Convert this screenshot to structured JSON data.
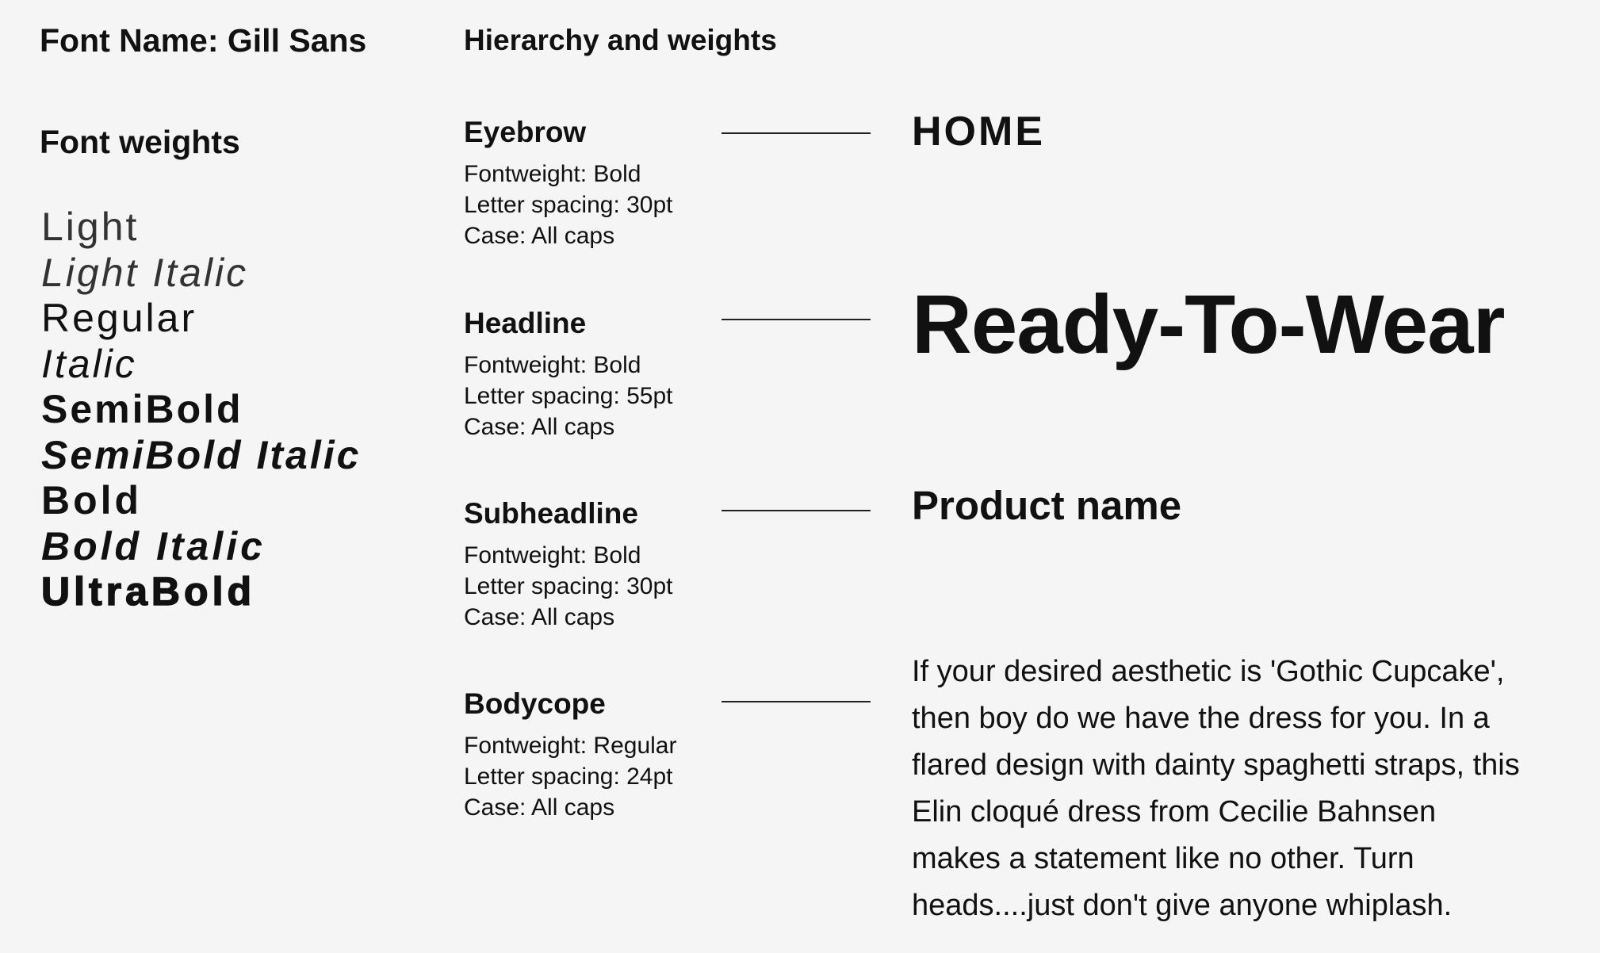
{
  "left": {
    "font_name": "Font Name: Gill Sans",
    "weights_title": "Font weights",
    "weights": [
      "Light",
      "Light Italic",
      "Regular",
      "Italic",
      "SemiBold",
      "SemiBold Italic",
      "Bold",
      "Bold Italic",
      "UltraBold"
    ]
  },
  "hierarchy": {
    "title": "Hierarchy and weights",
    "specs": [
      {
        "name": "Eyebrow",
        "fontweight": "Fontweight: Bold",
        "letter_spacing": "Letter spacing: 30pt",
        "case": "Case: All caps"
      },
      {
        "name": "Headline",
        "fontweight": "Fontweight: Bold",
        "letter_spacing": "Letter spacing: 55pt",
        "case": "Case: All caps"
      },
      {
        "name": "Subheadline",
        "fontweight": "Fontweight: Bold",
        "letter_spacing": "Letter spacing: 30pt",
        "case": "Case: All caps"
      },
      {
        "name": "Bodycope",
        "fontweight": "Fontweight: Regular",
        "letter_spacing": "Letter spacing: 24pt",
        "case": "Case: All caps"
      }
    ]
  },
  "examples": {
    "eyebrow": "HOME",
    "headline": "Ready-To-Wear",
    "subheadline": "Product name",
    "body_lines": [
      "If your desired aesthetic is 'Gothic Cupcake',",
      "then boy do we have the dress for you. In a",
      "flared design with dainty spaghetti straps, this",
      "Elin cloqué dress from Cecilie Bahnsen",
      "makes a statement like no other. Turn",
      "heads....just don't give anyone whiplash."
    ]
  }
}
